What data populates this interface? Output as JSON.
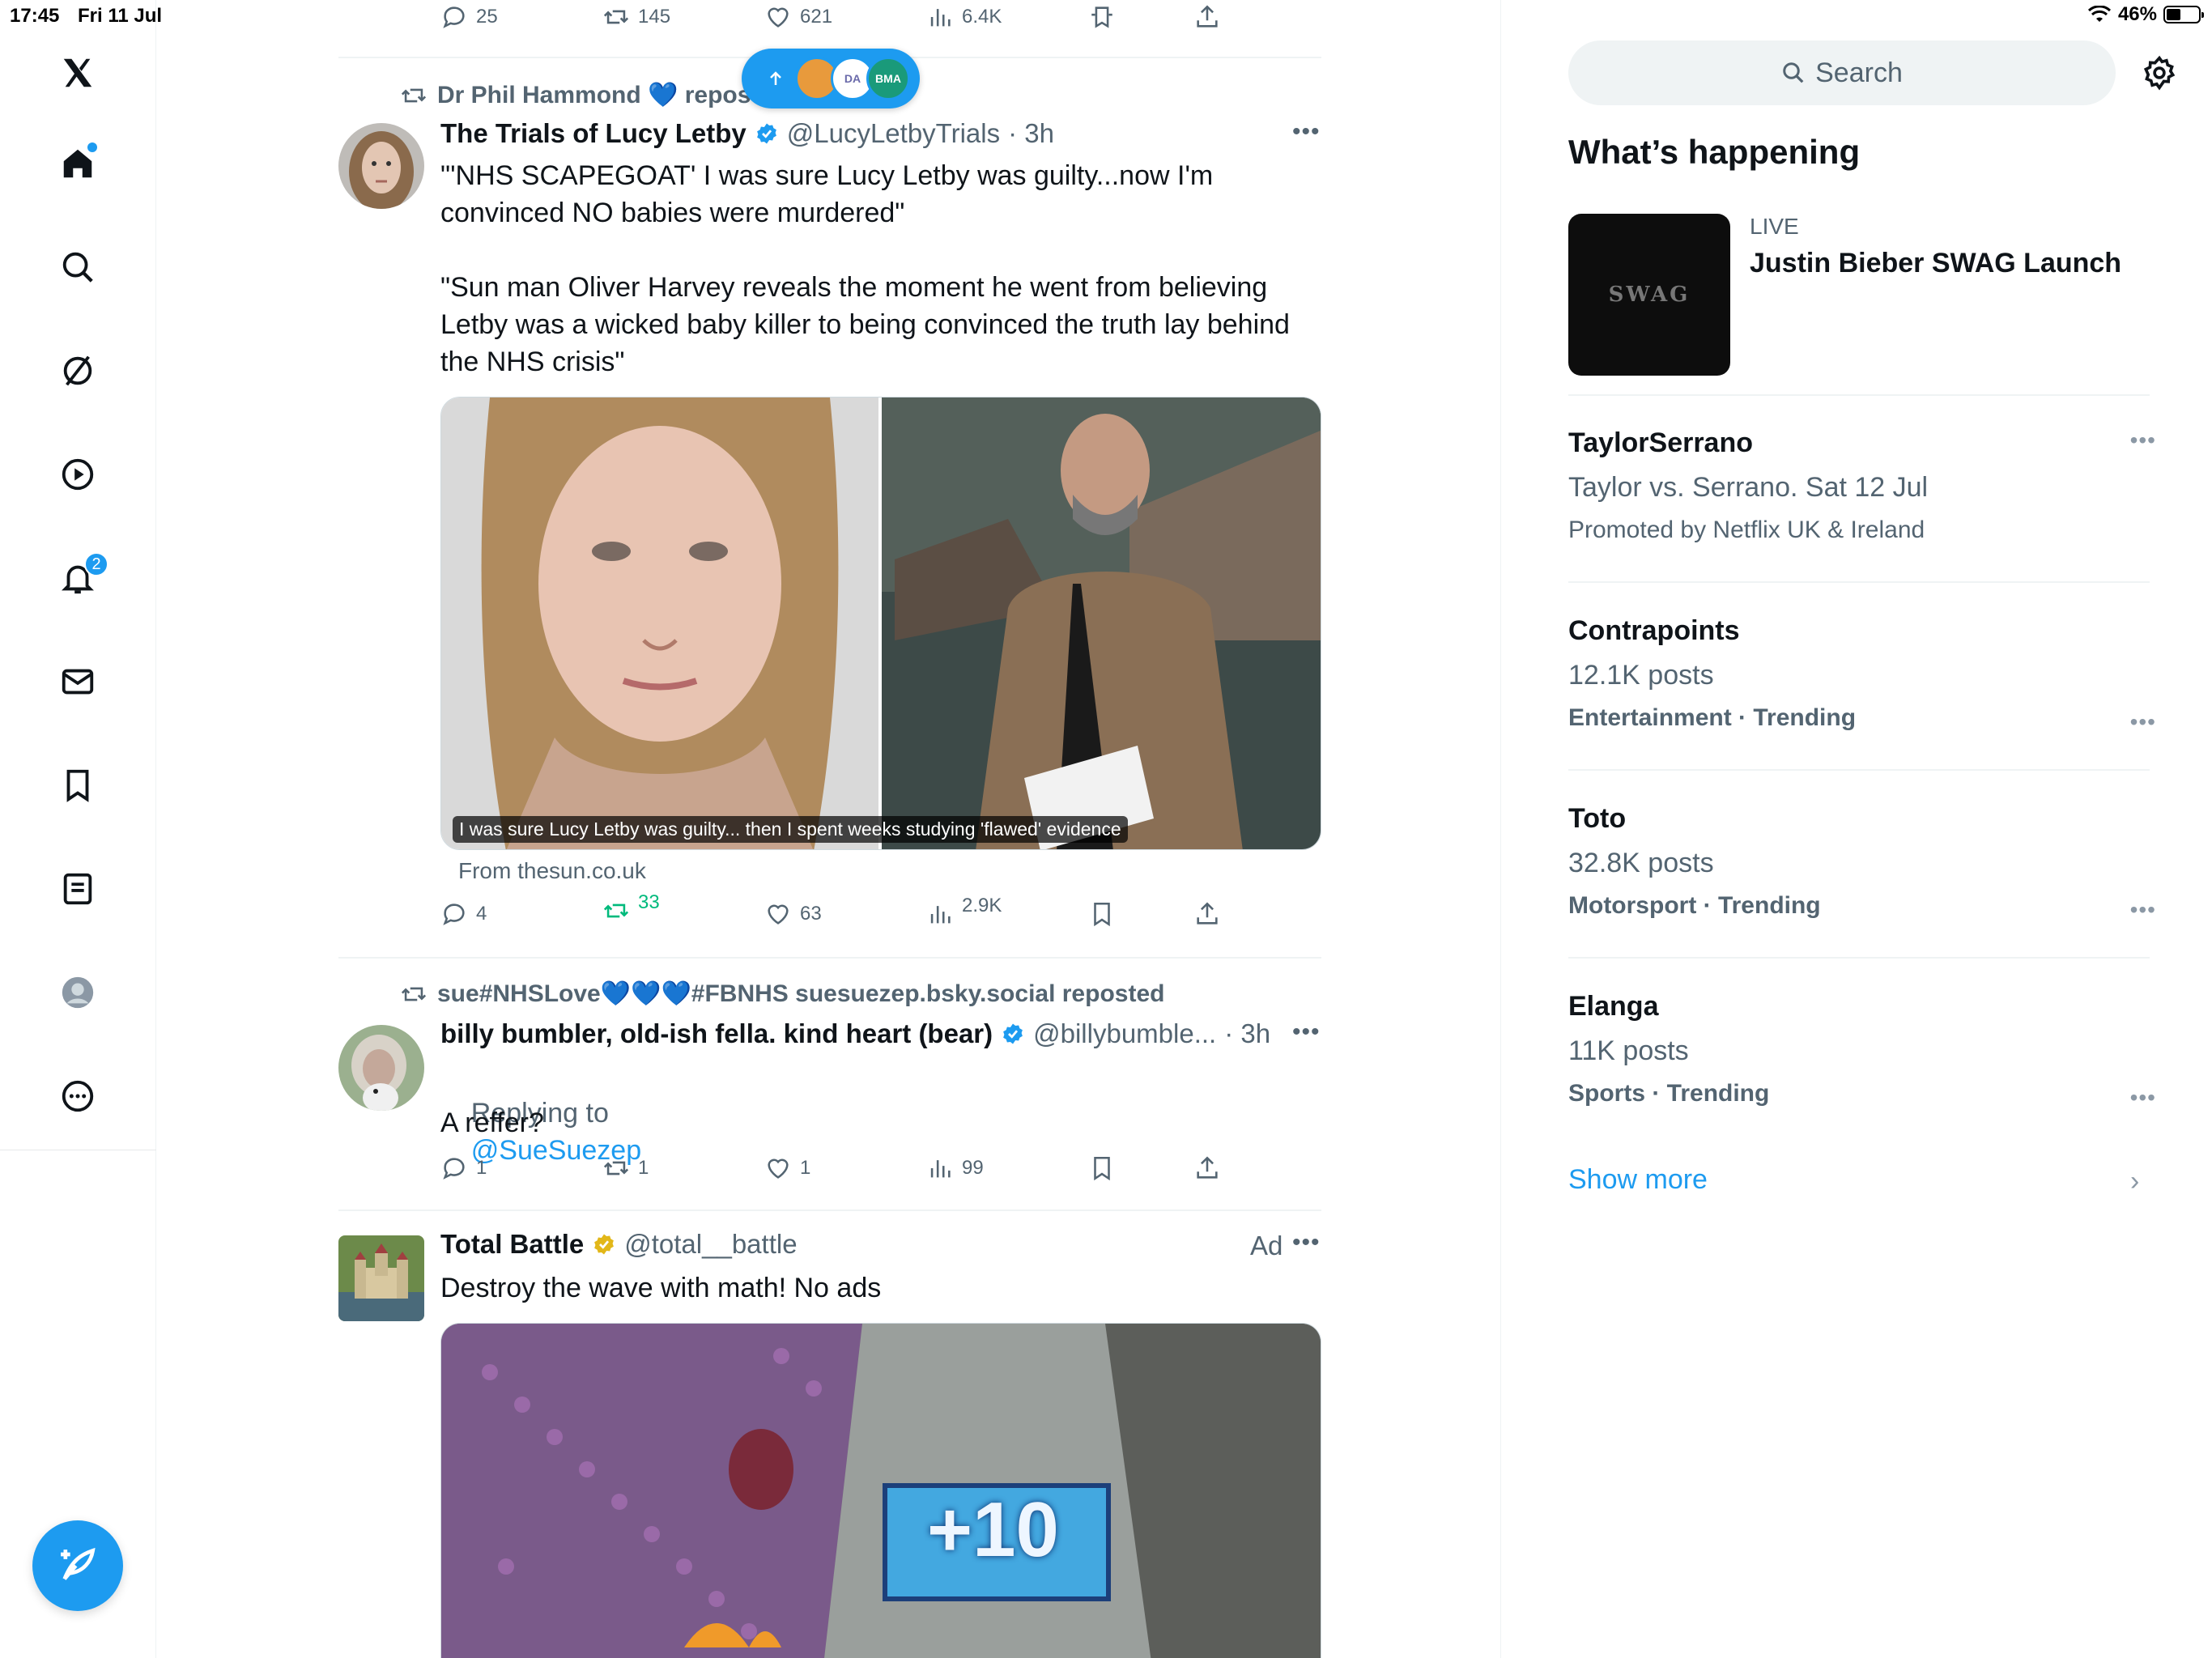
{
  "status_bar": {
    "time": "17:45",
    "date": "Fri 11 Jul",
    "battery": "46%"
  },
  "nav": {
    "notifications_badge": "2",
    "items": [
      "home",
      "search",
      "grok",
      "videos",
      "notifications",
      "messages",
      "bookmarks",
      "lists",
      "profile",
      "more"
    ]
  },
  "new_posts_pill": {
    "avatar_2": "DA",
    "avatar_3": "BMA"
  },
  "top_actions": {
    "replies": "25",
    "reposts": "145",
    "likes": "621",
    "views": "6.4K"
  },
  "tweet1": {
    "repost_by": "Dr Phil Hammond 💙 reposted",
    "name": "The Trials of Lucy Letby",
    "handle": "@LucyLetbyTrials",
    "time": "· 3h",
    "text": "\"'NHS SCAPEGOAT' I was sure Lucy Letby was guilty...now I'm convinced NO babies were murdered\"\n\n\"Sun man Oliver Harvey reveals the moment he went from believing Letby was a wicked baby killer to being convinced the truth lay behind the NHS crisis\"",
    "media_caption": "I was sure Lucy Letby was guilty... then I spent weeks studying 'flawed' evidence",
    "from": "From thesun.co.uk",
    "replies": "4",
    "reposts": "33",
    "likes": "63",
    "views": "2.9K"
  },
  "tweet2": {
    "repost_by": "sue#NHSLove💙💙💙#FBNHS suesuezep.bsky.social reposted",
    "name": "billy bumbler, old-ish fella. kind heart (bear)",
    "handle": "@billybumble...",
    "time": "· 3h",
    "replying_prefix": "Replying to",
    "replying_to": "@SueSuezep",
    "text": "A reffer?",
    "replies": "1",
    "reposts": "1",
    "likes": "1",
    "views": "99"
  },
  "tweet3": {
    "name": "Total Battle",
    "handle": "@total__battle",
    "ad_label": "Ad",
    "text": "Destroy the wave with math! No ads",
    "media_text": "+10"
  },
  "right": {
    "search_placeholder": "Search",
    "section_title": "What’s happening",
    "live": {
      "label": "LIVE",
      "title": "Justin Bieber SWAG Launch",
      "thumb_text": "SWAG"
    },
    "trends": [
      {
        "title": "TaylorSerrano",
        "line2": "Taylor vs. Serrano. Sat 12 Jul",
        "line3": "Promoted by Netflix UK & Ireland"
      },
      {
        "title": "Contrapoints",
        "line2": "12.1K posts",
        "line3": "Entertainment · Trending"
      },
      {
        "title": "Toto",
        "line2": "32.8K posts",
        "line3": "Motorsport · Trending"
      },
      {
        "title": "Elanga",
        "line2": "11K posts",
        "line3": "Sports · Trending"
      }
    ],
    "show_more": "Show more"
  }
}
